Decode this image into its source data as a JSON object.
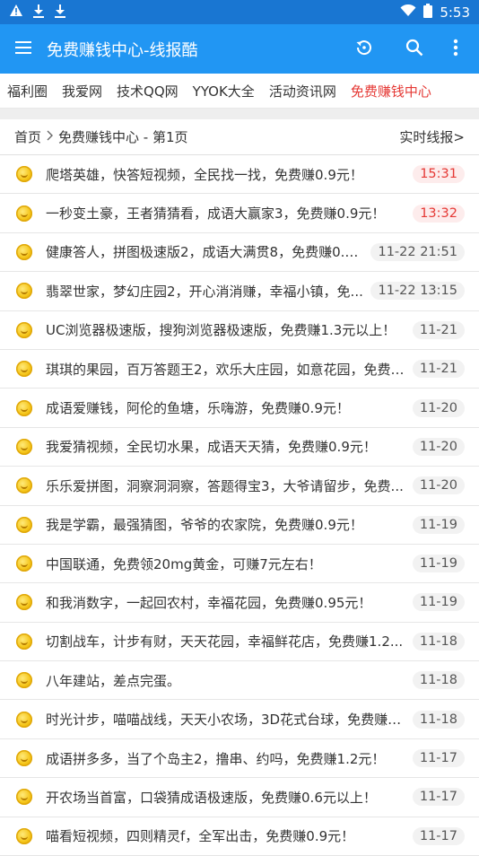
{
  "status_bar": {
    "time": "5:53",
    "icons_left": [
      "warning-icon",
      "download-icon",
      "download-icon"
    ],
    "icons_right": [
      "wifi-icon",
      "battery-icon"
    ]
  },
  "app_bar": {
    "title": "免费赚钱中心-线报酷",
    "icons": [
      "menu-icon",
      "history-icon",
      "search-icon",
      "more-vert-icon"
    ]
  },
  "nav_links": [
    {
      "label": "福利圈",
      "active": false
    },
    {
      "label": "我爱网",
      "active": false
    },
    {
      "label": "技术QQ网",
      "active": false
    },
    {
      "label": "YYOK大全",
      "active": false
    },
    {
      "label": "活动资讯网",
      "active": false
    },
    {
      "label": "免费赚钱中心",
      "active": true
    }
  ],
  "breadcrumb": {
    "home": "首页",
    "current": "免费赚钱中心 - 第1页",
    "realtime_link": "实时线报>"
  },
  "colors": {
    "status_bar": "#1976D2",
    "app_bar": "#2196F3",
    "active_link": "#e53935"
  },
  "items": [
    {
      "title": "爬塔英雄，快答短视频，全民找一找，免费赚0.9元！",
      "date": "15:31",
      "hot": true
    },
    {
      "title": "一秒变土豪，王者猜猜看，成语大赢家3，免费赚0.9元！",
      "date": "13:32",
      "hot": true
    },
    {
      "title": "健康答人，拼图极速版2，成语大满贯8，免费赚0.9...",
      "date": "11-22 21:51",
      "hot": false
    },
    {
      "title": "翡翠世家，梦幻庄园2，开心消消赚，幸福小镇，免...",
      "date": "11-22 13:15",
      "hot": false
    },
    {
      "title": "UC浏览器极速版，搜狗浏览器极速版，免费赚1.3元以上！",
      "date": "11-21",
      "hot": false
    },
    {
      "title": "琪琪的果园，百万答题王2，欢乐大庄园，如意花园，免费赚...",
      "date": "11-21",
      "hot": false
    },
    {
      "title": "成语爱赚钱，阿伦的鱼塘，乐嗨游，免费赚0.9元！",
      "date": "11-20",
      "hot": false
    },
    {
      "title": "我爱猜视频，全民切水果，成语天天猜，免费赚0.9元！",
      "date": "11-20",
      "hot": false
    },
    {
      "title": "乐乐爱拼图，洞察洞洞察，答题得宝3，大爷请留步，免费...",
      "date": "11-20",
      "hot": false
    },
    {
      "title": "我是学霸，最强猜图，爷爷的农家院，免费赚0.9元！",
      "date": "11-19",
      "hot": false
    },
    {
      "title": "中国联通，免费领20mg黄金，可赚7元左右！",
      "date": "11-19",
      "hot": false
    },
    {
      "title": "和我消数字，一起回农村，幸福花园，免费赚0.95元！",
      "date": "11-19",
      "hot": false
    },
    {
      "title": "切割战车，计步有财，天天花园，幸福鲜花店，免费赚1.2...",
      "date": "11-18",
      "hot": false
    },
    {
      "title": "八年建站，差点完蛋。",
      "date": "11-18",
      "hot": false
    },
    {
      "title": "时光计步，喵喵战线，天天小农场，3D花式台球，免费赚1...",
      "date": "11-18",
      "hot": false
    },
    {
      "title": "成语拼多多，当了个岛主2，撸串、约吗，免费赚1.2元！",
      "date": "11-17",
      "hot": false
    },
    {
      "title": "开农场当首富，口袋猜成语极速版，免费赚0.6元以上！",
      "date": "11-17",
      "hot": false
    },
    {
      "title": "喵看短视频，四则精灵f，全军出击，免费赚0.9元！",
      "date": "11-17",
      "hot": false
    }
  ]
}
